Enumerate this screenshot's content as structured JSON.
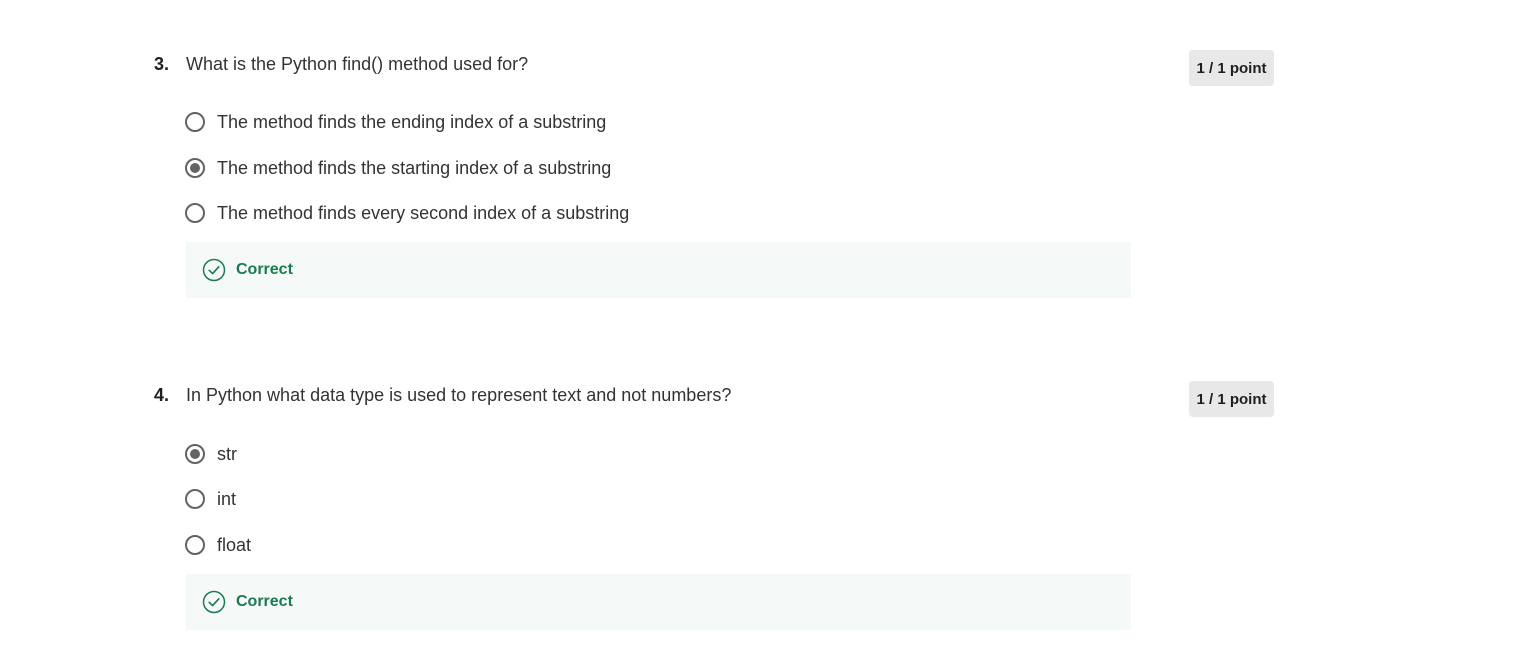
{
  "questions": [
    {
      "number": "3.",
      "text": "What is the Python find() method used for?",
      "points": "1 / 1 point",
      "options": [
        {
          "label": "The method finds the ending index of a substring",
          "selected": false
        },
        {
          "label": "The method finds the starting index of a substring",
          "selected": true
        },
        {
          "label": "The method finds every second index of a substring",
          "selected": false
        }
      ],
      "feedback": "Correct"
    },
    {
      "number": "4.",
      "text": "In Python what data type is used to represent text and not numbers?",
      "points": "1 / 1 point",
      "options": [
        {
          "label": "str",
          "selected": true
        },
        {
          "label": "int",
          "selected": false
        },
        {
          "label": "float",
          "selected": false
        }
      ],
      "feedback": "Correct"
    }
  ],
  "colors": {
    "correct": "#1b7a4f",
    "radio": "#636363",
    "badge_bg": "#e8e8e8",
    "feedback_bg": "#f5f9f8"
  },
  "icons": {
    "feedback": "check-circle-icon",
    "option": "radio-icon"
  }
}
